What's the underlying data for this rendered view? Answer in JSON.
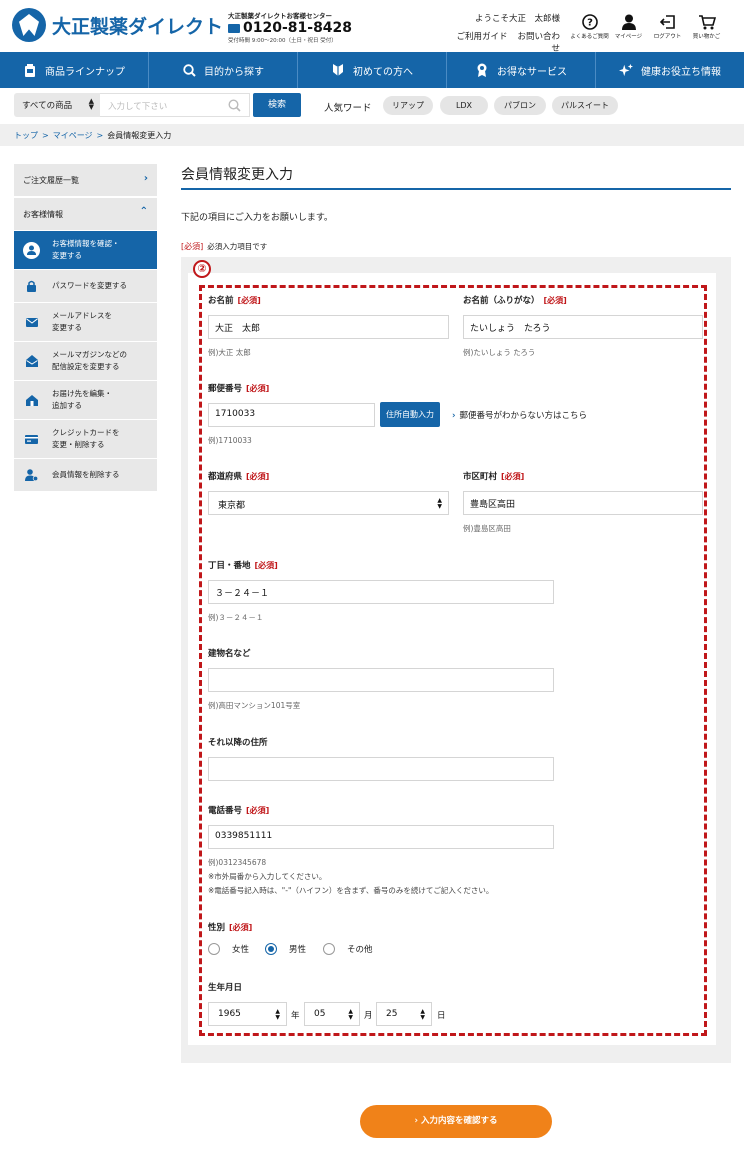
{
  "header": {
    "logo": "大正製薬ダイレクト",
    "call_title": "大正製薬ダイレクトお客様センター",
    "call_number": "0120-81-8428",
    "call_hours": "受付時間 9:00〜20:00（土日・祝日 受付）",
    "welcome": "ようこそ大正　太郎様",
    "guide": "ご利用ガイド",
    "contact": "お問い合わせ",
    "icons": [
      {
        "label": "よくあるご質問",
        "icon": "question-icon"
      },
      {
        "label": "マイページ",
        "icon": "user-icon"
      },
      {
        "label": "ログアウト",
        "icon": "logout-icon"
      },
      {
        "label": "買い物かご",
        "icon": "cart-icon"
      }
    ]
  },
  "nav": [
    {
      "label": "商品ラインナップ",
      "icon": "bottle-icon"
    },
    {
      "label": "目的から探す",
      "icon": "search-icon"
    },
    {
      "label": "初めての方へ",
      "icon": "leaf-icon"
    },
    {
      "label": "お得なサービス",
      "icon": "medal-icon"
    },
    {
      "label": "健康お役立ち情報",
      "icon": "sparkle-icon"
    }
  ],
  "search": {
    "category": "すべての商品",
    "placeholder": "入力して下さい",
    "button": "検索",
    "popular_label": "人気ワード",
    "chips": [
      "リアップ",
      "LDX",
      "パブロン",
      "パルスイート"
    ]
  },
  "breadcrumb": {
    "top": "トップ",
    "mypage": "マイページ",
    "current": "会員情報変更入力",
    "sep": ">"
  },
  "sidebar": {
    "order_history": "ご注文履歴一覧",
    "customer_info": "お客様情報",
    "items": [
      {
        "label": "お客様情報を確認・\n変更する",
        "active": true
      },
      {
        "label": "パスワードを変更する",
        "active": false
      },
      {
        "label": "メールアドレスを\n変更する",
        "active": false
      },
      {
        "label": "メールマガジンなどの\n配信設定を変更する",
        "active": false
      },
      {
        "label": "お届け先を編集・\n追加する",
        "active": false
      },
      {
        "label": "クレジットカードを\n変更・削除する",
        "active": false
      },
      {
        "label": "会員情報を削除する",
        "active": false
      }
    ]
  },
  "main": {
    "title": "会員情報変更入力",
    "lead": "下記の項目にご入力をお願いします。",
    "legend_req": "[必須]",
    "legend_text": "必須入力項目です",
    "step_marker": "②",
    "required": "[必須]"
  },
  "form": {
    "name_label": "お名前",
    "name_value": "大正　太郎",
    "name_example": "例)大正 太郎",
    "kana_label": "お名前（ふりがな）",
    "kana_value": "たいしょう　たろう",
    "kana_example": "例)たいしょう たろう",
    "zip_label": "郵便番号",
    "zip_value": "1710033",
    "zip_button": "住所自動入力",
    "zip_link": "郵便番号がわからない方はこちら",
    "zip_example": "例)1710033",
    "pref_label": "都道府県",
    "pref_value": "東京都",
    "city_label": "市区町村",
    "city_value": "豊島区高田",
    "city_example": "例)豊島区高田",
    "street_label": "丁目・番地",
    "street_value": "３－２４－１",
    "street_example": "例)３－２４－１",
    "building_label": "建物名など",
    "building_value": "",
    "building_example": "例)高田マンション101号室",
    "other_label": "それ以降の住所",
    "other_value": "",
    "tel_label": "電話番号",
    "tel_value": "0339851111",
    "tel_example": "例)0312345678",
    "tel_note1": "※市外局番から入力してください。",
    "tel_note2": "※電話番号記入時は、\"-\"（ハイフン）を含まず、番号のみを続けてご記入ください。",
    "gender_label": "性別",
    "gender_options": [
      "女性",
      "男性",
      "その他"
    ],
    "gender_selected": "男性",
    "birth_label": "生年月日",
    "birth_year": "1965",
    "birth_month": "05",
    "birth_day": "25",
    "unit_year": "年",
    "unit_month": "月",
    "unit_day": "日",
    "submit": "入力内容を確認する"
  },
  "colors": {
    "brand": "#1565a8",
    "accent": "#f08219",
    "required": "#c0171a"
  }
}
